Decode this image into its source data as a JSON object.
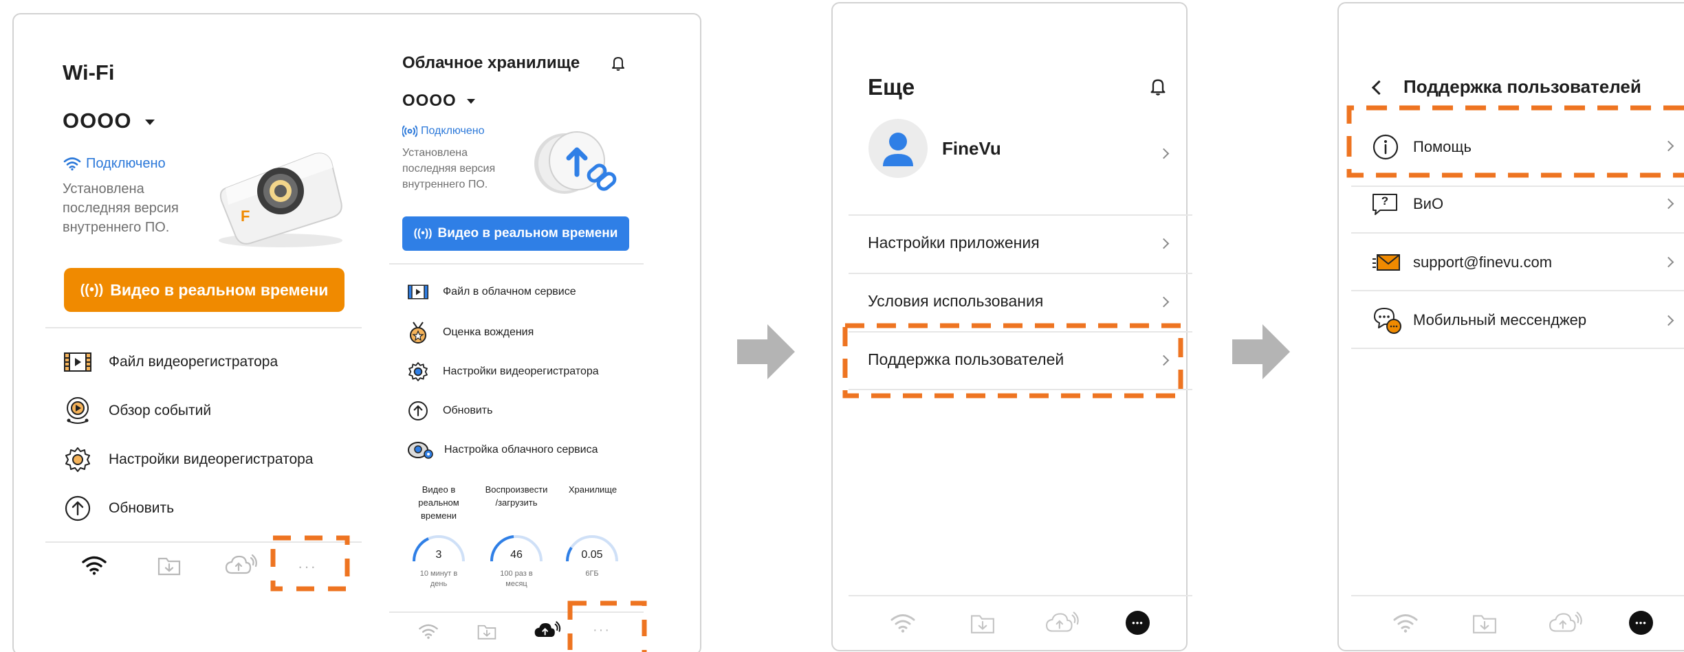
{
  "panel1": {
    "wifi_title": "Wi-Fi",
    "device_name": "OOOO",
    "status": "Подключено",
    "firmware_note": [
      "Установлена",
      "последняя версия",
      "внутреннего ПО."
    ],
    "live_button": "Видео в реальном времени",
    "menu": [
      {
        "label": "Файл видеорегистратора",
        "icon": "film-icon"
      },
      {
        "label": "Обзор событий",
        "icon": "event-review-icon"
      },
      {
        "label": "Настройки видеорегистратора",
        "icon": "gear-icon"
      },
      {
        "label": "Обновить",
        "icon": "upload-arrow-icon"
      }
    ],
    "more_glyph": "···",
    "cloud": {
      "title": "Облачное хранилище",
      "device_name": "OOOO",
      "status": "Подключено",
      "firmware_note": [
        "Установлена",
        "последняя версия",
        "внутреннего ПО."
      ],
      "live_button": "Видео в реальном времени",
      "menu": [
        {
          "label": "Файл в облачном сервисе",
          "icon": "film-icon"
        },
        {
          "label": "Оценка вождения",
          "icon": "medal-icon"
        },
        {
          "label": "Настройки видеорегистратора",
          "icon": "gear-icon"
        },
        {
          "label": "Обновить",
          "icon": "upload-arrow-icon"
        },
        {
          "label": "Настройка облачного сервиса",
          "icon": "cloud-settings-icon"
        }
      ],
      "stats": [
        {
          "header": [
            "Видео в",
            "реальном",
            "времени"
          ],
          "value": "3",
          "sub": [
            "10 минут в",
            "день"
          ],
          "fill": 0.3
        },
        {
          "header": [
            "Воспроизвести",
            "/загрузить"
          ],
          "value": "46",
          "sub": [
            "100 раз в",
            "месяц"
          ],
          "fill": 0.46
        },
        {
          "header": [
            "Хранилище"
          ],
          "value": "0.05",
          "sub": [
            "6ГБ"
          ],
          "fill": 0.05
        }
      ],
      "more_glyph": "···"
    }
  },
  "panel2": {
    "title": "Еще",
    "user": "FineVu",
    "items": [
      "Настройки приложения",
      "Условия использования",
      "Поддержка пользователей"
    ],
    "more_glyph": "•••"
  },
  "panel3": {
    "title": "Поддержка пользователей",
    "items": [
      {
        "label": "Помощь",
        "icon": "info-icon"
      },
      {
        "label": "ВиО",
        "icon": "faq-icon"
      },
      {
        "label": "support@finevu.com",
        "icon": "mail-icon"
      },
      {
        "label": "Мобильный мессенджер",
        "icon": "chat-icon"
      }
    ],
    "faq_glyph": "?",
    "more_glyph": "•••"
  },
  "colors": {
    "accent_orange": "#f08a00",
    "highlight_dash": "#ee7421",
    "link_blue": "#2b78d9",
    "button_blue": "#2f7fe6",
    "arrow_gray": "#b4b4b4"
  }
}
